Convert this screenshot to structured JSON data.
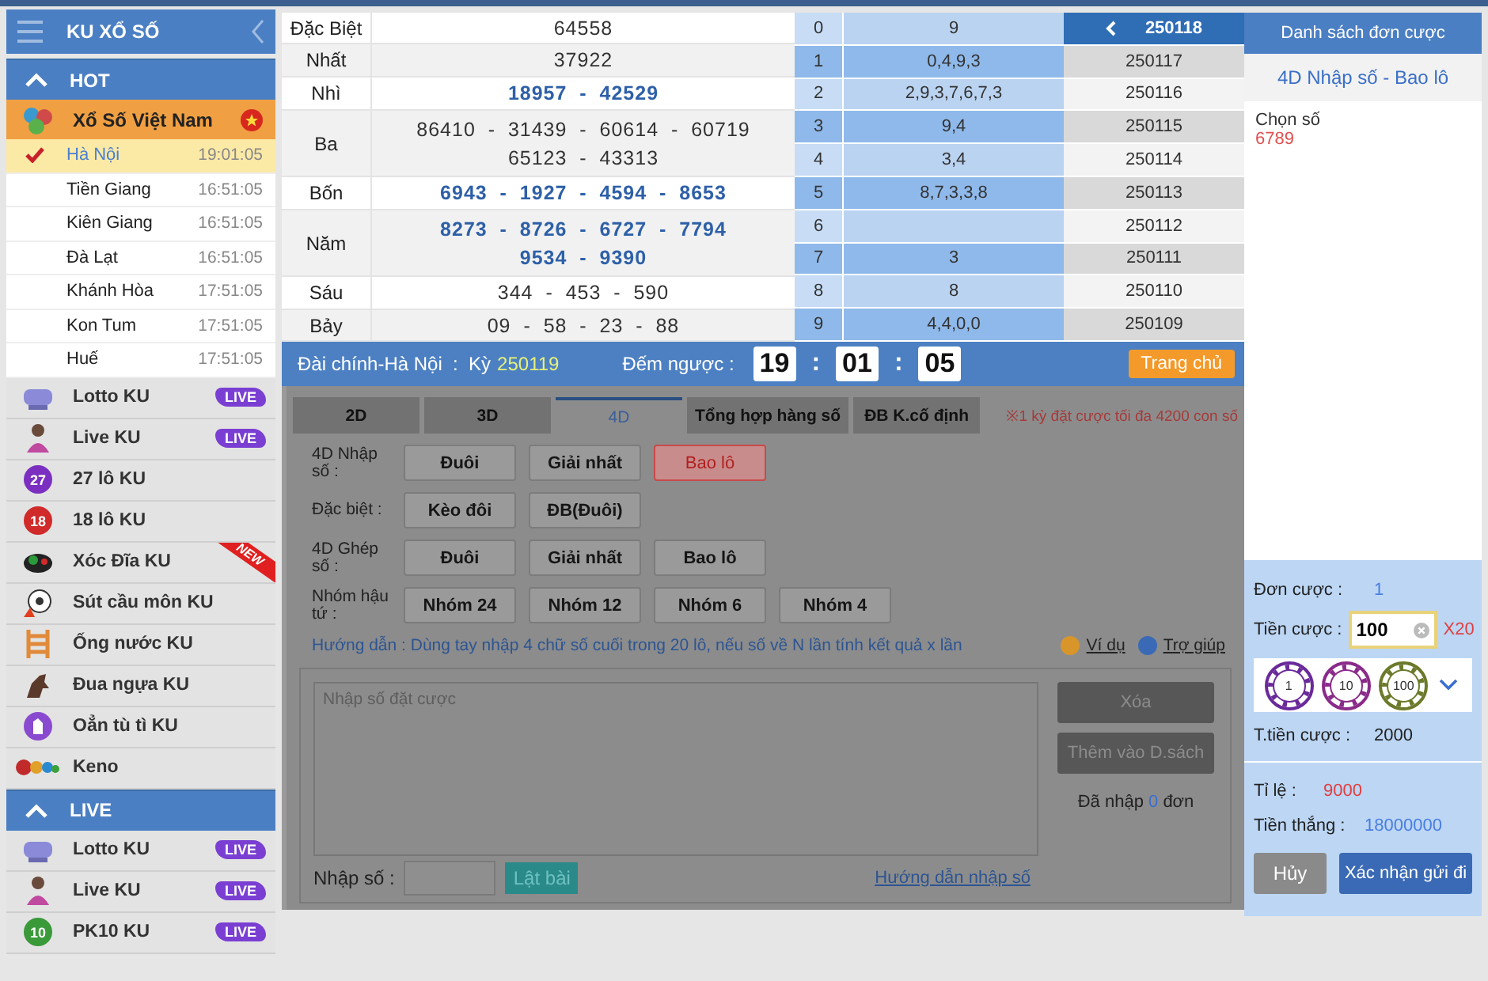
{
  "sidebar": {
    "title": "KU XỔ SỐ",
    "sections": [
      {
        "label": "HOT",
        "expanded": true,
        "items": [
          {
            "kind": "group",
            "name": "Xổ Số Việt Nam"
          },
          {
            "kind": "sub",
            "name": "Hà Nội",
            "time": "19:01:05",
            "selected": true
          },
          {
            "kind": "sub",
            "name": "Tiền Giang",
            "time": "16:51:05",
            "selected": false
          },
          {
            "kind": "sub",
            "name": "Kiên Giang",
            "time": "16:51:05",
            "selected": false
          },
          {
            "kind": "sub",
            "name": "Đà Lạt",
            "time": "16:51:05",
            "selected": false
          },
          {
            "kind": "sub",
            "name": "Khánh Hòa",
            "time": "17:51:05",
            "selected": false
          },
          {
            "kind": "sub",
            "name": "Kon Tum",
            "time": "17:51:05",
            "selected": false
          },
          {
            "kind": "sub",
            "name": "Huế",
            "time": "17:51:05",
            "selected": false
          },
          {
            "kind": "game",
            "name": "Lotto KU",
            "badge": {
              "kind": "live",
              "text": "LIVE"
            }
          },
          {
            "kind": "game",
            "name": "Live KU",
            "badge": {
              "kind": "live",
              "text": "LIVE"
            }
          },
          {
            "kind": "game",
            "name": "27 lô KU",
            "icon_text": "27",
            "color": "#7b2fc0"
          },
          {
            "kind": "game",
            "name": "18 lô KU",
            "icon_text": "18",
            "color": "#d02a2a"
          },
          {
            "kind": "game",
            "name": "Xóc Đĩa KU",
            "badge": {
              "kind": "new",
              "text": "NEW"
            }
          },
          {
            "kind": "game",
            "name": "Sút cầu môn KU"
          },
          {
            "kind": "game",
            "name": "Ống nước KU"
          },
          {
            "kind": "game",
            "name": "Đua ngựa KU"
          },
          {
            "kind": "game",
            "name": "Oẳn tù tì KU"
          },
          {
            "kind": "game",
            "name": "Keno"
          }
        ]
      },
      {
        "label": "LIVE",
        "expanded": true,
        "items": [
          {
            "kind": "game",
            "name": "Lotto KU",
            "badge": {
              "kind": "live",
              "text": "LIVE"
            }
          },
          {
            "kind": "game",
            "name": "Live KU",
            "badge": {
              "kind": "live",
              "text": "LIVE"
            }
          },
          {
            "kind": "game",
            "name": "PK10 KU",
            "icon_text": "10",
            "color": "#3a9a3a",
            "badge": {
              "kind": "live",
              "text": "LIVE"
            }
          }
        ]
      }
    ]
  },
  "results": [
    {
      "label": "Đặc Biệt",
      "lines": [
        "64558"
      ],
      "highlight": false
    },
    {
      "label": "Nhất",
      "lines": [
        "37922"
      ],
      "highlight": false
    },
    {
      "label": "Nhì",
      "lines": [
        "18957  -  42529"
      ],
      "highlight": true
    },
    {
      "label": "Ba",
      "lines": [
        "86410  -  31439  -  60614  -  60719",
        "65123  -  43313"
      ],
      "highlight": false
    },
    {
      "label": "Bốn",
      "lines": [
        "6943  -  1927  -  4594  -  8653"
      ],
      "highlight": true
    },
    {
      "label": "Năm",
      "lines": [
        "8273  -  8726  -  6727  -  7794",
        "9534  -  9390"
      ],
      "highlight": true
    },
    {
      "label": "Sáu",
      "lines": [
        "344  -  453  -  590"
      ],
      "highlight": false
    },
    {
      "label": "Bảy",
      "lines": [
        "09  -  58  -  23  -  88"
      ],
      "highlight": false
    }
  ],
  "heads": [
    {
      "head": "0",
      "tails": "9"
    },
    {
      "head": "1",
      "tails": "0,4,9,3"
    },
    {
      "head": "2",
      "tails": "2,9,3,7,6,7,3"
    },
    {
      "head": "3",
      "tails": "9,4"
    },
    {
      "head": "4",
      "tails": "3,4"
    },
    {
      "head": "5",
      "tails": "8,7,3,3,8"
    },
    {
      "head": "6"
    },
    {
      "head": "7",
      "tails": "3"
    },
    {
      "head": "8",
      "tails": "8"
    },
    {
      "head": "9",
      "tails": "4,4,0,0"
    }
  ],
  "periods": [
    {
      "label": "250118",
      "selected": true
    },
    {
      "label": "250117",
      "selected": false
    },
    {
      "label": "250116",
      "selected": false
    },
    {
      "label": "250115",
      "selected": false
    },
    {
      "label": "250114",
      "selected": false
    },
    {
      "label": "250113",
      "selected": false
    },
    {
      "label": "250112",
      "selected": false
    },
    {
      "label": "250111",
      "selected": false
    },
    {
      "label": "250110",
      "selected": false
    },
    {
      "label": "250109",
      "selected": false
    }
  ],
  "info_bar": {
    "station": "Đài chính-Hà Nội  :  Kỳ",
    "period": "250119",
    "countdown_label": "Đếm ngược :",
    "countdown": [
      "19",
      "01",
      "05"
    ],
    "separator": ":",
    "home_button": "Trang chủ"
  },
  "bet_tabs": [
    {
      "label": "2D",
      "selected": false
    },
    {
      "label": "3D",
      "selected": false
    },
    {
      "label": "4D",
      "selected": true
    },
    {
      "label": "Tổng hợp hàng số",
      "selected": false
    },
    {
      "label": "ĐB K.cố định",
      "selected": false
    }
  ],
  "notice": "※1 kỳ đặt cược tối đa 4200 con số",
  "bet_types": [
    {
      "label": "4D Nhập số :",
      "options": [
        {
          "label": "Đuôi",
          "selected": false
        },
        {
          "label": "Giải nhất",
          "selected": false
        },
        {
          "label": "Bao lô",
          "selected": true
        }
      ]
    },
    {
      "label": "Đặc biệt :",
      "options": [
        {
          "label": "Kèo đôi",
          "selected": false
        },
        {
          "label": "ĐB(Đuôi)",
          "selected": false
        }
      ]
    },
    {
      "label": "4D Ghép số :",
      "options": [
        {
          "label": "Đuôi",
          "selected": false
        },
        {
          "label": "Giải nhất",
          "selected": false
        },
        {
          "label": "Bao lô",
          "selected": false
        }
      ]
    },
    {
      "label": "Nhóm hậu tứ :",
      "options": [
        {
          "label": "Nhóm 24",
          "selected": false
        },
        {
          "label": "Nhóm 12",
          "selected": false
        },
        {
          "label": "Nhóm 6",
          "selected": false
        },
        {
          "label": "Nhóm 4",
          "selected": false
        }
      ]
    }
  ],
  "guide": "Hướng dẫn : Dùng tay nhập 4 chữ số cuối trong 20 lô, nếu số về N lần tính kết quả x lần",
  "help_links": [
    "Ví dụ",
    "Trợ giúp"
  ],
  "entry": {
    "placeholder": "Nhập số đặt cược",
    "clear_button": "Xóa",
    "add_button": "Thêm vào D.sách",
    "buttons_disabled": true,
    "count_before": "Đã nhập",
    "count": "0",
    "count_after": "đơn",
    "number_label": "Nhập số :",
    "flip_button": "Lật bài",
    "guide_link": "Hướng dẫn nhập số"
  },
  "bet_list": {
    "title": "Danh sách đơn cược",
    "subtitle": "4D Nhập số - Bao lô",
    "pick_label": "Chọn số",
    "pick_value": "6789",
    "orders_label": "Đơn cược :",
    "orders": "1",
    "stake_label": "Tiền cược :",
    "stake": "100",
    "multiplier": "X20",
    "chips": [
      {
        "label": "1",
        "color": "#6a2a9a"
      },
      {
        "label": "10",
        "color": "#8a2a8a"
      },
      {
        "label": "100",
        "color": "#6a7a2a"
      }
    ],
    "total_label": "T.tiền cược :",
    "total": "2000",
    "odds_label": "Tỉ lệ :",
    "odds": "9000",
    "win_label": "Tiền thắng :",
    "win": "18000000",
    "cancel_button": "Hủy",
    "confirm_button": "Xác nhận gửi đi"
  }
}
